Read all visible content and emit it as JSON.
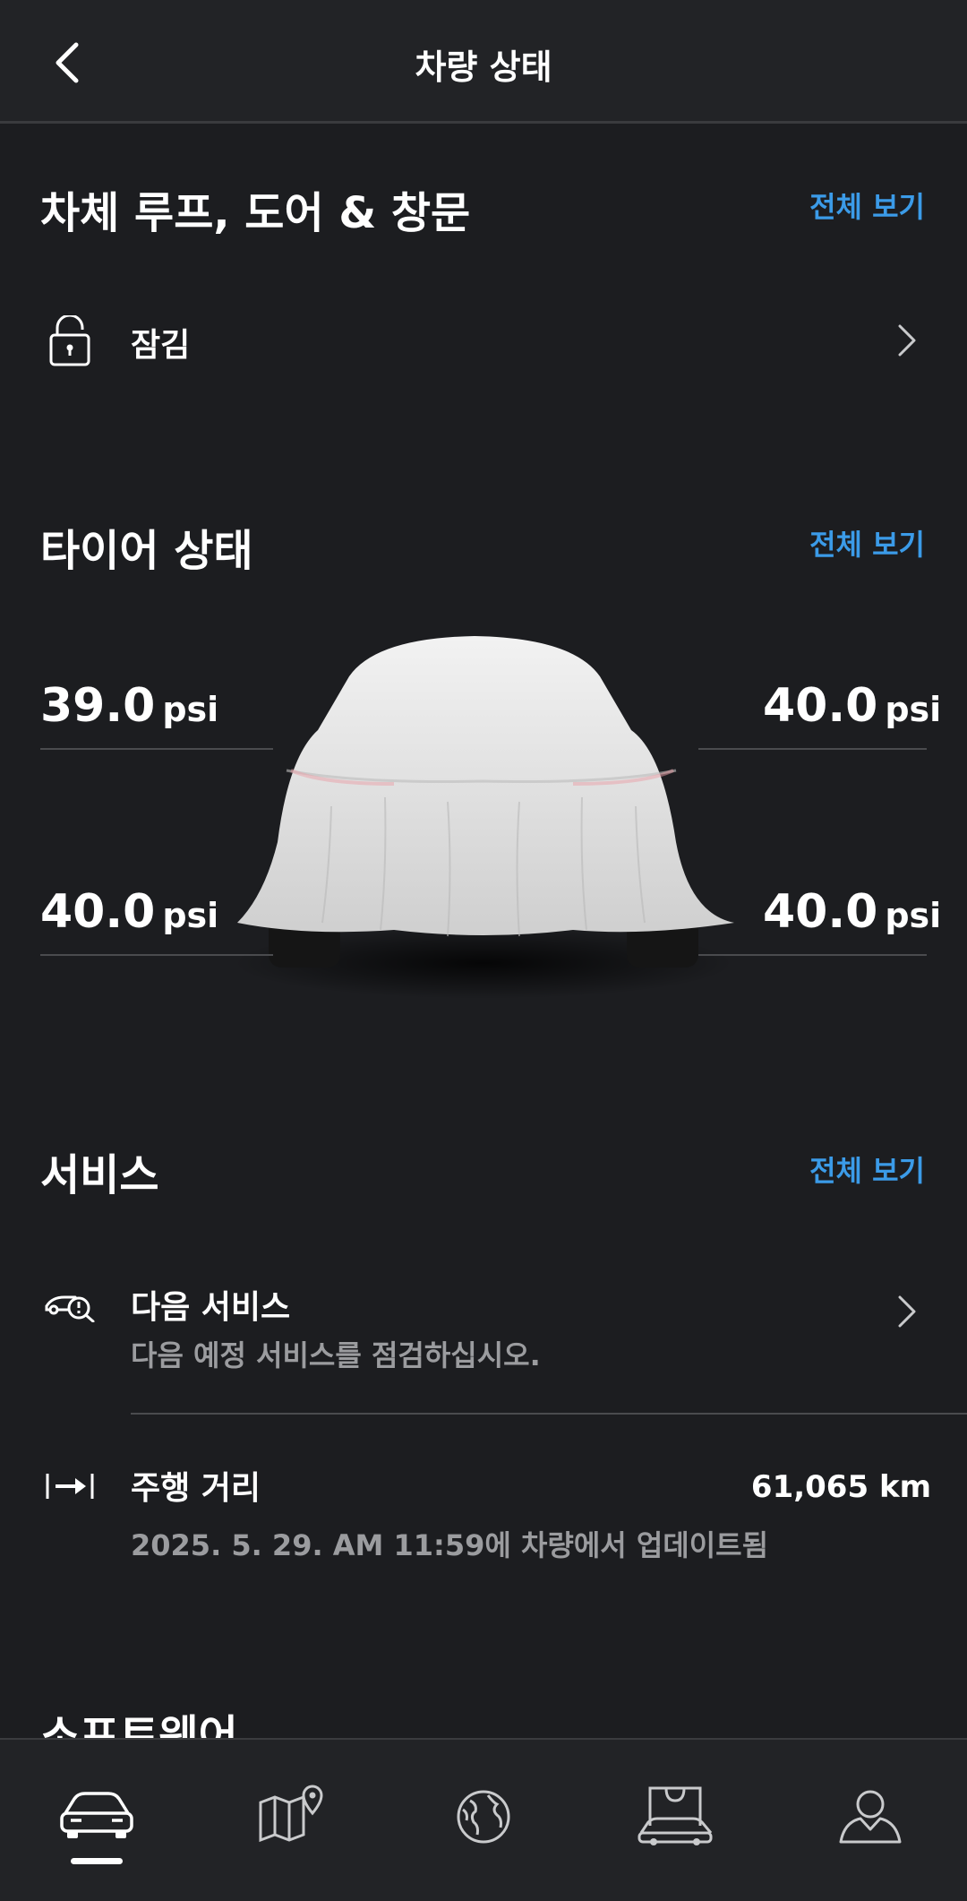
{
  "header": {
    "title": "차량 상태"
  },
  "body_section": {
    "title": "차체 루프, 도어 & 창문",
    "see_all": "전체 보기",
    "lock_status": "잠김"
  },
  "tire_section": {
    "title": "타이어 상태",
    "see_all": "전체 보기",
    "unit": "psi",
    "front_left": "39.0",
    "front_right": "40.0",
    "rear_left": "40.0",
    "rear_right": "40.0"
  },
  "service_section": {
    "title": "서비스",
    "see_all": "전체 보기",
    "next_service": {
      "label": "다음 서비스",
      "sub": "다음 예정 서비스를 점검하십시오."
    },
    "mileage": {
      "label": "주행 거리",
      "sub": "2025. 5. 29. AM 11:59에 차량에서 업데이트됨",
      "value": "61,065 km"
    }
  },
  "software_section": {
    "title": "소프트웨어"
  },
  "bottom_nav": {
    "items": [
      "car-icon",
      "map-pin-icon",
      "globe-icon",
      "shopping-bag-car-icon",
      "profile-icon"
    ],
    "active_index": 0
  }
}
